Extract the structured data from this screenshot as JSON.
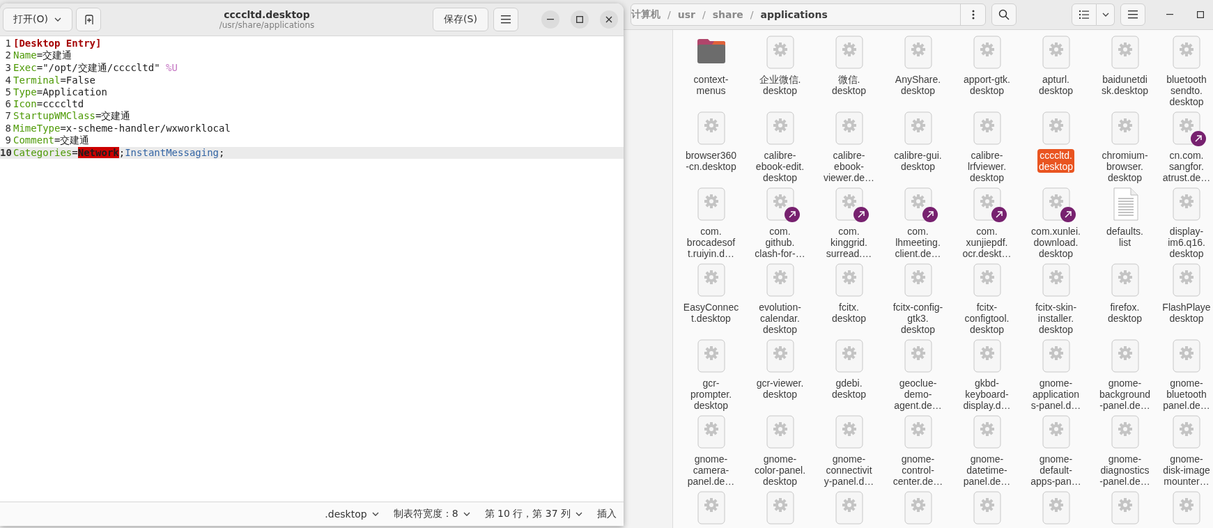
{
  "editor": {
    "open_button": "打开(O)",
    "title": "ccccltd.desktop",
    "subtitle": "/usr/share/applications",
    "save_button": "保存(S)",
    "lines": [
      {
        "number": "1",
        "current": false,
        "segments": [
          {
            "kind": "section",
            "text": "[Desktop Entry]"
          }
        ]
      },
      {
        "number": "2",
        "current": false,
        "segments": [
          {
            "kind": "key",
            "text": "Name"
          },
          {
            "kind": "plain",
            "text": "=交建通"
          }
        ]
      },
      {
        "number": "3",
        "current": false,
        "segments": [
          {
            "kind": "key",
            "text": "Exec"
          },
          {
            "kind": "plain",
            "text": "=\"/opt/交建通/ccccltd\" "
          },
          {
            "kind": "code",
            "text": "%U"
          }
        ]
      },
      {
        "number": "4",
        "current": false,
        "segments": [
          {
            "kind": "key",
            "text": "Terminal"
          },
          {
            "kind": "plain",
            "text": "=False"
          }
        ]
      },
      {
        "number": "5",
        "current": false,
        "segments": [
          {
            "kind": "key",
            "text": "Type"
          },
          {
            "kind": "plain",
            "text": "=Application"
          }
        ]
      },
      {
        "number": "6",
        "current": false,
        "segments": [
          {
            "kind": "key",
            "text": "Icon"
          },
          {
            "kind": "plain",
            "text": "=ccccltd"
          }
        ]
      },
      {
        "number": "7",
        "current": false,
        "segments": [
          {
            "kind": "key",
            "text": "StartupWMClass"
          },
          {
            "kind": "plain",
            "text": "=交建通"
          }
        ]
      },
      {
        "number": "8",
        "current": false,
        "segments": [
          {
            "kind": "key",
            "text": "MimeType"
          },
          {
            "kind": "plain",
            "text": "=x-scheme-handler/wxworklocal"
          }
        ]
      },
      {
        "number": "9",
        "current": false,
        "segments": [
          {
            "kind": "key",
            "text": "Comment"
          },
          {
            "kind": "plain",
            "text": "=交建通"
          }
        ]
      },
      {
        "number": "10",
        "current": true,
        "segments": [
          {
            "kind": "key",
            "text": "Categories"
          },
          {
            "kind": "plain",
            "text": "="
          },
          {
            "kind": "error",
            "text": "Network"
          },
          {
            "kind": "plain",
            "text": ";"
          },
          {
            "kind": "value",
            "text": "InstantMessaging"
          },
          {
            "kind": "plain",
            "text": ";"
          }
        ]
      }
    ],
    "status_bar": {
      "language": ".desktop",
      "tab_width": "制表符宽度：8",
      "cursor_position": "第 10 行，第 37 列",
      "insert_mode": "插入"
    }
  },
  "file_manager": {
    "path": [
      {
        "kind": "crumb",
        "text": "计算机",
        "current": false
      },
      {
        "kind": "separator",
        "text": "/"
      },
      {
        "kind": "crumb",
        "text": "usr",
        "current": false
      },
      {
        "kind": "separator",
        "text": "/"
      },
      {
        "kind": "crumb",
        "text": "share",
        "current": false
      },
      {
        "kind": "separator",
        "text": "/"
      },
      {
        "kind": "crumb",
        "text": "applications",
        "current": true
      }
    ],
    "items": [
      {
        "kind": "folder",
        "label": "context-\nmenus",
        "symlink": false,
        "selected": false
      },
      {
        "kind": "settings",
        "label": "企业微信.\ndesktop",
        "symlink": false,
        "selected": false
      },
      {
        "kind": "settings",
        "label": "微信.\ndesktop",
        "symlink": false,
        "selected": false
      },
      {
        "kind": "settings",
        "label": "AnyShare.\ndesktop",
        "symlink": false,
        "selected": false
      },
      {
        "kind": "settings",
        "label": "apport-gtk.\ndesktop",
        "symlink": false,
        "selected": false
      },
      {
        "kind": "settings",
        "label": "apturl.\ndesktop",
        "symlink": false,
        "selected": false
      },
      {
        "kind": "settings",
        "label": "baidunetdi\nsk.desktop",
        "symlink": false,
        "selected": false
      },
      {
        "kind": "settings",
        "label": "bluetooth\nsendto.\ndesktop",
        "symlink": false,
        "selected": false
      },
      {
        "kind": "settings",
        "label": "browser360\n-cn.desktop",
        "symlink": false,
        "selected": false
      },
      {
        "kind": "settings",
        "label": "calibre-\nebook-edit.\ndesktop",
        "symlink": false,
        "selected": false
      },
      {
        "kind": "settings",
        "label": "calibre-\nebook-\nviewer.de…",
        "symlink": false,
        "selected": false
      },
      {
        "kind": "settings",
        "label": "calibre-gui.\ndesktop",
        "symlink": false,
        "selected": false
      },
      {
        "kind": "settings",
        "label": "calibre-\nlrfviewer.\ndesktop",
        "symlink": false,
        "selected": false
      },
      {
        "kind": "settings",
        "label": "ccccltd.\ndesktop",
        "symlink": false,
        "selected": true
      },
      {
        "kind": "settings",
        "label": "chromium-\nbrowser.\ndesktop",
        "symlink": false,
        "selected": false
      },
      {
        "kind": "settings",
        "label": "cn.com.\nsangfor.\natrust.de…",
        "symlink": true,
        "selected": false
      },
      {
        "kind": "settings",
        "label": "com.\nbrocadesof\nt.ruiyin.d…",
        "symlink": false,
        "selected": false
      },
      {
        "kind": "settings",
        "label": "com.\ngithub.\nclash-for-…",
        "symlink": true,
        "selected": false
      },
      {
        "kind": "settings",
        "label": "com.\nkinggrid.\nsurread.…",
        "symlink": true,
        "selected": false
      },
      {
        "kind": "settings",
        "label": "com.\nlhmeeting.\nclient.de…",
        "symlink": true,
        "selected": false
      },
      {
        "kind": "settings",
        "label": "com.\nxunjiepdf.\nocr.deskt…",
        "symlink": true,
        "selected": false
      },
      {
        "kind": "settings",
        "label": "com.xunlei.\ndownload.\ndesktop",
        "symlink": true,
        "selected": false
      },
      {
        "kind": "text",
        "label": "defaults.\nlist",
        "symlink": false,
        "selected": false
      },
      {
        "kind": "settings",
        "label": "display-\nim6.q16.\ndesktop",
        "symlink": false,
        "selected": false
      },
      {
        "kind": "settings",
        "label": "EasyConnec\nt.desktop",
        "symlink": false,
        "selected": false
      },
      {
        "kind": "settings",
        "label": "evolution-\ncalendar.\ndesktop",
        "symlink": false,
        "selected": false
      },
      {
        "kind": "settings",
        "label": "fcitx.\ndesktop",
        "symlink": false,
        "selected": false
      },
      {
        "kind": "settings",
        "label": "fcitx-config-\ngtk3.\ndesktop",
        "symlink": false,
        "selected": false
      },
      {
        "kind": "settings",
        "label": "fcitx-\nconfigtool.\ndesktop",
        "symlink": false,
        "selected": false
      },
      {
        "kind": "settings",
        "label": "fcitx-skin-\ninstaller.\ndesktop",
        "symlink": false,
        "selected": false
      },
      {
        "kind": "settings",
        "label": "firefox.\ndesktop",
        "symlink": false,
        "selected": false
      },
      {
        "kind": "settings",
        "label": "FlashPlaye\ndesktop",
        "symlink": false,
        "selected": false
      },
      {
        "kind": "settings",
        "label": "gcr-\nprompter.\ndesktop",
        "symlink": false,
        "selected": false
      },
      {
        "kind": "settings",
        "label": "gcr-viewer.\ndesktop",
        "symlink": false,
        "selected": false
      },
      {
        "kind": "settings",
        "label": "gdebi.\ndesktop",
        "symlink": false,
        "selected": false
      },
      {
        "kind": "settings",
        "label": "geoclue-\ndemo-\nagent.de…",
        "symlink": false,
        "selected": false
      },
      {
        "kind": "settings",
        "label": "gkbd-\nkeyboard-\ndisplay.d…",
        "symlink": false,
        "selected": false
      },
      {
        "kind": "settings",
        "label": "gnome-\napplication\ns-panel.d…",
        "symlink": false,
        "selected": false
      },
      {
        "kind": "settings",
        "label": "gnome-\nbackground\n-panel.de…",
        "symlink": false,
        "selected": false
      },
      {
        "kind": "settings",
        "label": "gnome-\nbluetooth\npanel.de…",
        "symlink": false,
        "selected": false
      },
      {
        "kind": "settings",
        "label": "gnome-\ncamera-\npanel.de…",
        "symlink": false,
        "selected": false
      },
      {
        "kind": "settings",
        "label": "gnome-\ncolor-panel.\ndesktop",
        "symlink": false,
        "selected": false
      },
      {
        "kind": "settings",
        "label": "gnome-\nconnectivit\ny-panel.d…",
        "symlink": false,
        "selected": false
      },
      {
        "kind": "settings",
        "label": "gnome-\ncontrol-\ncenter.de…",
        "symlink": false,
        "selected": false
      },
      {
        "kind": "settings",
        "label": "gnome-\ndatetime-\npanel.de…",
        "symlink": false,
        "selected": false
      },
      {
        "kind": "settings",
        "label": "gnome-\ndefault-\napps-pan…",
        "symlink": false,
        "selected": false
      },
      {
        "kind": "settings",
        "label": "gnome-\ndiagnostics\n-panel.de…",
        "symlink": false,
        "selected": false
      },
      {
        "kind": "settings",
        "label": "gnome-\ndisk-image\nmounter…",
        "symlink": false,
        "selected": false
      },
      {
        "kind": "settings",
        "symlink": false,
        "selected": false
      },
      {
        "kind": "settings",
        "symlink": false,
        "selected": false
      },
      {
        "kind": "settings",
        "symlink": false,
        "selected": false
      },
      {
        "kind": "settings",
        "symlink": false,
        "selected": false
      },
      {
        "kind": "settings",
        "symlink": false,
        "selected": false
      },
      {
        "kind": "settings",
        "symlink": false,
        "selected": false
      },
      {
        "kind": "settings",
        "symlink": false,
        "selected": false
      },
      {
        "kind": "settings",
        "symlink": false,
        "selected": false
      }
    ]
  }
}
